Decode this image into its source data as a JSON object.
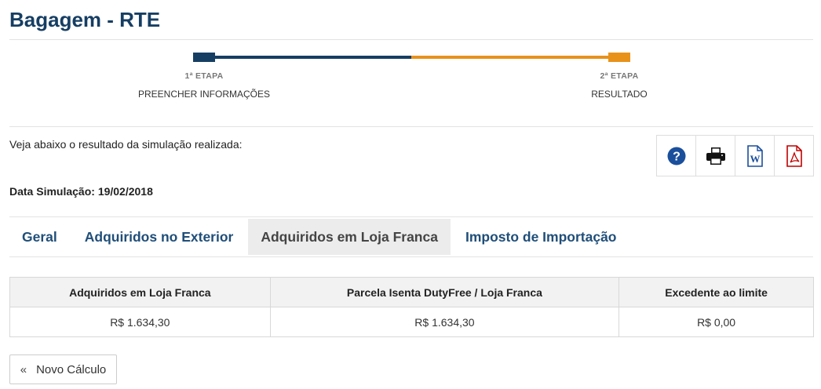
{
  "header": {
    "title": "Bagagem - RTE"
  },
  "steps": [
    {
      "number": "1ª ETAPA",
      "label": "PREENCHER INFORMAÇÕES"
    },
    {
      "number": "2ª ETAPA",
      "label": "RESULTADO"
    }
  ],
  "progress": {
    "current_step": 2,
    "total_steps": 2,
    "colors": {
      "done": "#163e63",
      "current": "#e8921a"
    }
  },
  "intro": "Veja abaixo o resultado da simulação realizada:",
  "simulation_date": "Data Simulação: 19/02/2018",
  "toolbar": {
    "icons": [
      "help-icon",
      "print-icon",
      "word-icon",
      "pdf-icon"
    ],
    "colors": {
      "help": "#1a4f9c",
      "word": "#1a4f9c",
      "pdf": "#c00000"
    }
  },
  "tabs": [
    {
      "label": "Geral",
      "active": false
    },
    {
      "label": "Adquiridos no Exterior",
      "active": false
    },
    {
      "label": "Adquiridos em Loja Franca",
      "active": true
    },
    {
      "label": "Imposto de Importação",
      "active": false
    }
  ],
  "table": {
    "headers": [
      "Adquiridos em Loja Franca",
      "Parcela Isenta DutyFree / Loja Franca",
      "Excedente ao limite"
    ],
    "rows": [
      [
        "R$ 1.634,30",
        "R$ 1.634,30",
        "R$ 0,00"
      ]
    ]
  },
  "new_calc_button": {
    "icon": "«",
    "label": "Novo Cálculo"
  }
}
